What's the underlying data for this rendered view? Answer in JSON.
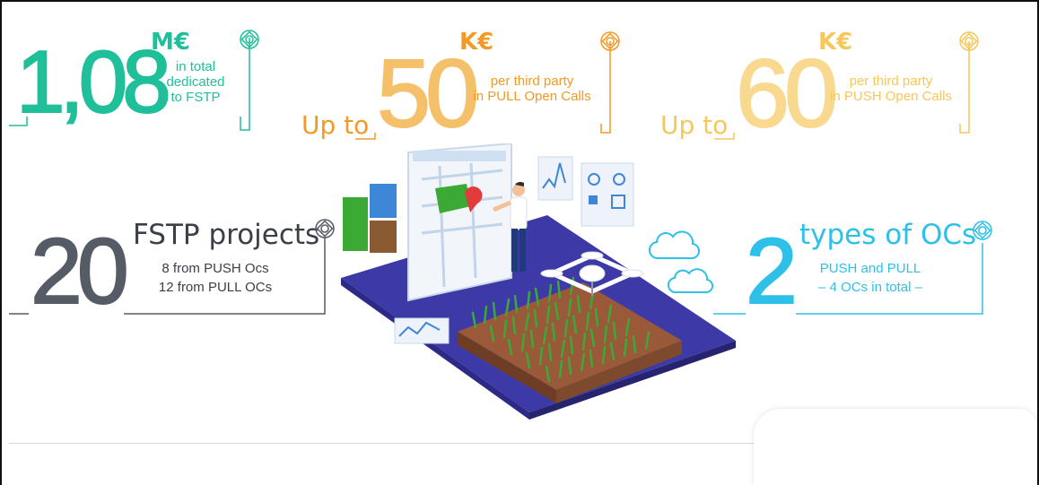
{
  "colors": {
    "teal": "#1fbf9a",
    "orange": "#f29a25",
    "yellow": "#f6c75a",
    "gray": "#555c66",
    "blue": "#2ec0e8",
    "platform": "#3d3aa8",
    "soil": "#9a5a3a",
    "crop": "#3aaa35"
  },
  "stat_total": {
    "number": "1,08",
    "unit": "M€",
    "line1": "in total",
    "line2": "dedicated",
    "line3": "to FSTP"
  },
  "stat_pull": {
    "prefix": "Up to",
    "number": "50",
    "unit": "K€",
    "line1": "per third party",
    "line2": "in PULL Open Calls"
  },
  "stat_push": {
    "prefix": "Up to",
    "number": "60",
    "unit": "K€",
    "line1": "per third party",
    "line2": "in PUSH Open Calls"
  },
  "stat_projects": {
    "number": "20",
    "title": "FSTP projects",
    "line1": "8 from PUSH Ocs",
    "line2": "12 from PULL OCs"
  },
  "stat_types": {
    "number": "2",
    "title": "types of OCs",
    "line1": "PUSH and PULL",
    "line2": "– 4 OCs in total –"
  },
  "icons": {
    "logo": "ringed-knot-logo-icon",
    "cloud": "cloud-icon",
    "drone": "drone-icon",
    "person": "farmer-person-icon"
  }
}
